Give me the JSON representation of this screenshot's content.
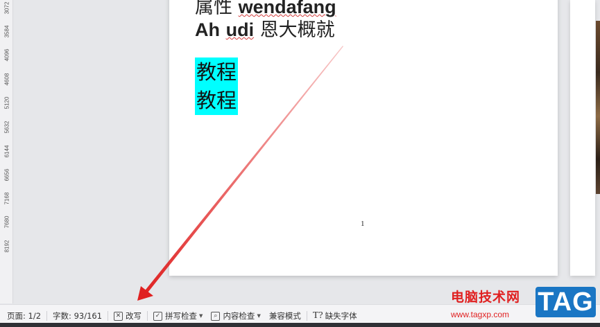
{
  "ruler": {
    "ticks": [
      "3072",
      "3584",
      "4096",
      "4608",
      "5120",
      "5632",
      "6144",
      "6656",
      "7168",
      "7680",
      "8192"
    ]
  },
  "document": {
    "partial_line_cjk": "属性",
    "partial_line_bold": "wendafang",
    "line2_word1": "Ah",
    "line2_word2": "udi",
    "line2_cjk": "恩大概就",
    "highlight_1": "教程",
    "highlight_2": "教程",
    "page_number": "1",
    "highlight_color": "#00ffff"
  },
  "statusbar": {
    "page": "页面: 1/2",
    "word_count": "字数: 93/161",
    "overwrite": "改写",
    "spell_check": "拼写检查",
    "content_check": "内容检查",
    "compat_mode": "兼容模式",
    "missing_fonts": "缺失字体"
  },
  "watermark": {
    "site_name": "电脑技术网",
    "url": "www.tagxp.com",
    "tag": "TAG",
    "color": "#e02020",
    "tag_bg": "#1a76c4"
  },
  "annotation": {
    "arrow_color": "#e02020"
  }
}
